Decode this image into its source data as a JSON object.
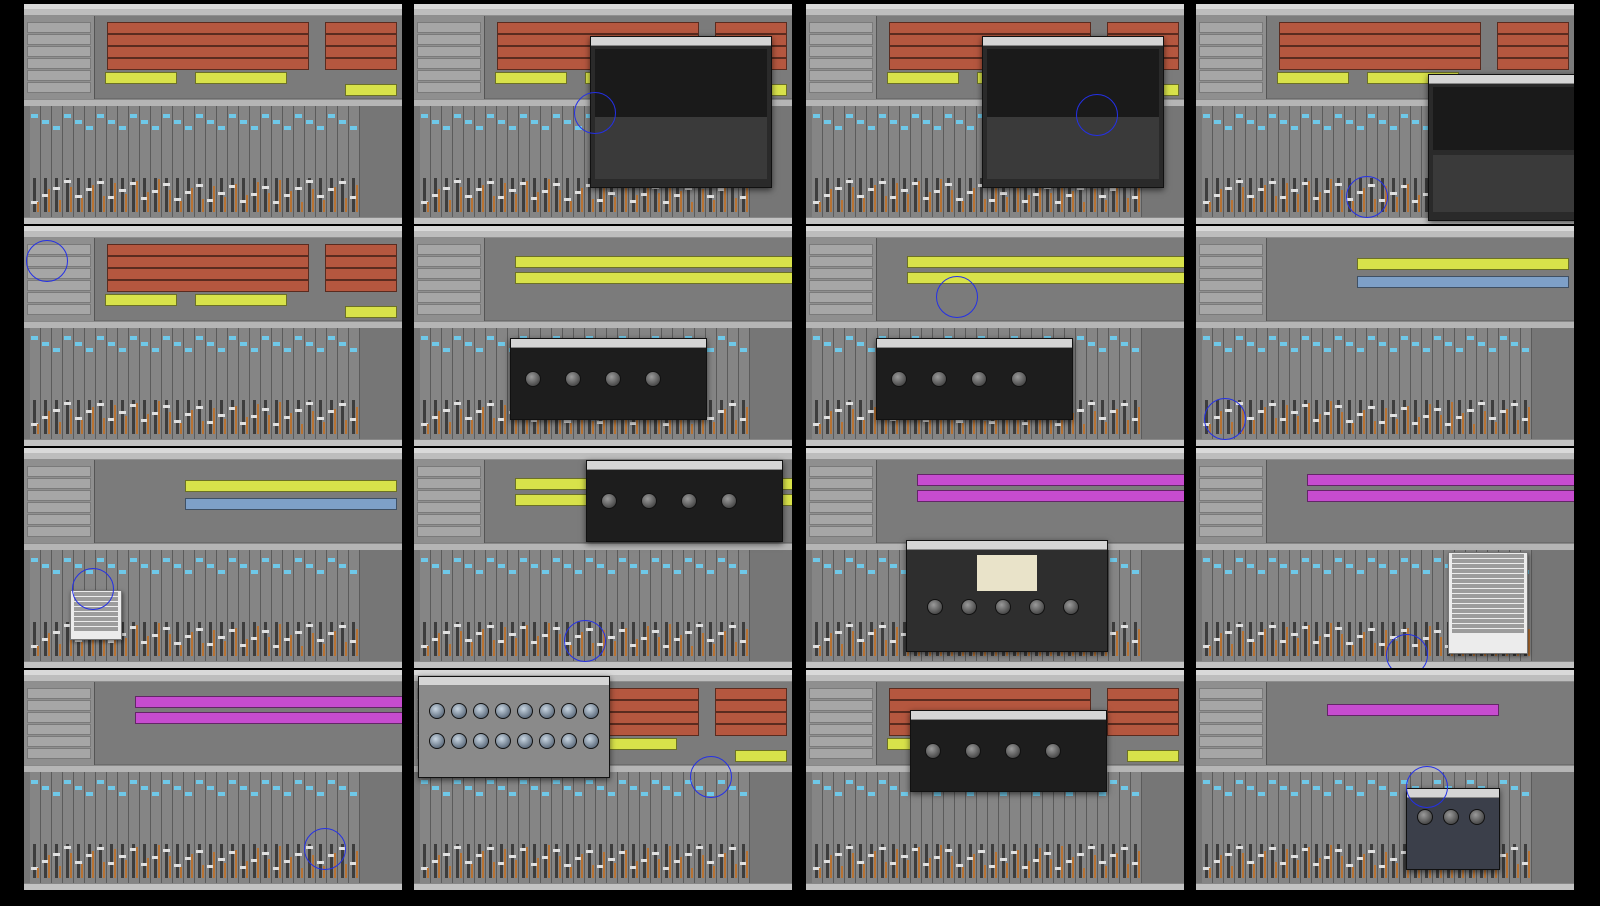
{
  "title": "",
  "colors": {
    "background": "#000000",
    "window": "#6c6c6c",
    "region_red": "#b5573f",
    "region_yellow": "#d8e24a",
    "region_magenta": "#c64ccf",
    "region_blue": "#7ea0c8",
    "insert_blue": "#6fc8e8",
    "cursor_circle": "#2430e6"
  },
  "thumbnails": [
    {
      "kind": "arrange-red",
      "plugin": null,
      "cursor": null
    },
    {
      "kind": "arrange-red",
      "plugin": "reverb",
      "cursor": "mixer-left"
    },
    {
      "kind": "arrange-red",
      "plugin": "reverb",
      "cursor": "plugin-mid"
    },
    {
      "kind": "arrange-red",
      "plugin": "reverb-room",
      "cursor": "mixer-mid"
    },
    {
      "kind": "arrange-red",
      "plugin": null,
      "cursor": "tracklist-top"
    },
    {
      "kind": "arrange-yellow",
      "plugin": "panman",
      "cursor": null
    },
    {
      "kind": "arrange-yellow",
      "plugin": "panman",
      "cursor": "region"
    },
    {
      "kind": "arrange-yellow-blue",
      "plugin": null,
      "cursor": "bottom-left"
    },
    {
      "kind": "arrange-yellow-blue",
      "plugin": "menu",
      "cursor": "menu"
    },
    {
      "kind": "arrange-yellow",
      "plugin": "panman",
      "cursor": "mixer-mid"
    },
    {
      "kind": "arrange-magenta",
      "plugin": "decapitator",
      "cursor": null
    },
    {
      "kind": "arrange-magenta",
      "plugin": "menu-right",
      "cursor": "bottom-right"
    },
    {
      "kind": "arrange-magenta",
      "plugin": null,
      "cursor": "mixer-right"
    },
    {
      "kind": "arrange-red",
      "plugin": "channelstrip",
      "cursor": "menu-right"
    },
    {
      "kind": "arrange-red",
      "plugin": "panman",
      "cursor": null
    },
    {
      "kind": "arrange-magenta-small",
      "plugin": "noisegate",
      "cursor": "noisegate"
    }
  ]
}
